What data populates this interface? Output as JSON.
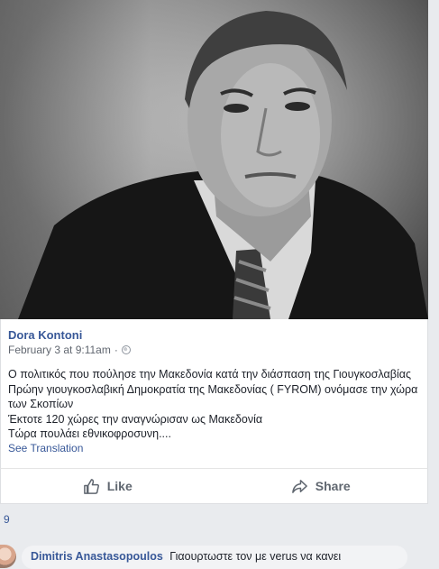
{
  "post": {
    "author": "Dora Kontoni",
    "timestamp": "February 3 at 9:11am",
    "separator": "·",
    "privacy_icon": "globe-icon",
    "text_lines": [
      "Ο πολιτικός που πούλησε την Μακεδονία κατά την διάσπαση της Γιουγκοσλαβίας",
      "Πρώην γιουγκοσλαβική Δημοκρατία της Μακεδονίας ( FYROM) ονόμασε την χώρα",
      "των Σκοπίων",
      "Έκτοτε 120 χώρες την αναγνώρισαν ως Μακεδονία",
      "Τώρα πουλάει εθνικοφροσυνη...."
    ],
    "see_translation": "See Translation",
    "photo_description_icon": "portrait-photo"
  },
  "actions": {
    "like_label": "Like",
    "share_label": "Share",
    "like_icon": "thumbs-up-icon",
    "share_icon": "share-arrow-icon"
  },
  "reactions": {
    "count": "9"
  },
  "comment": {
    "author": "Dimitris Anastasopoulos",
    "text": "Γιαουρτωστε τον με verus να κανει"
  }
}
